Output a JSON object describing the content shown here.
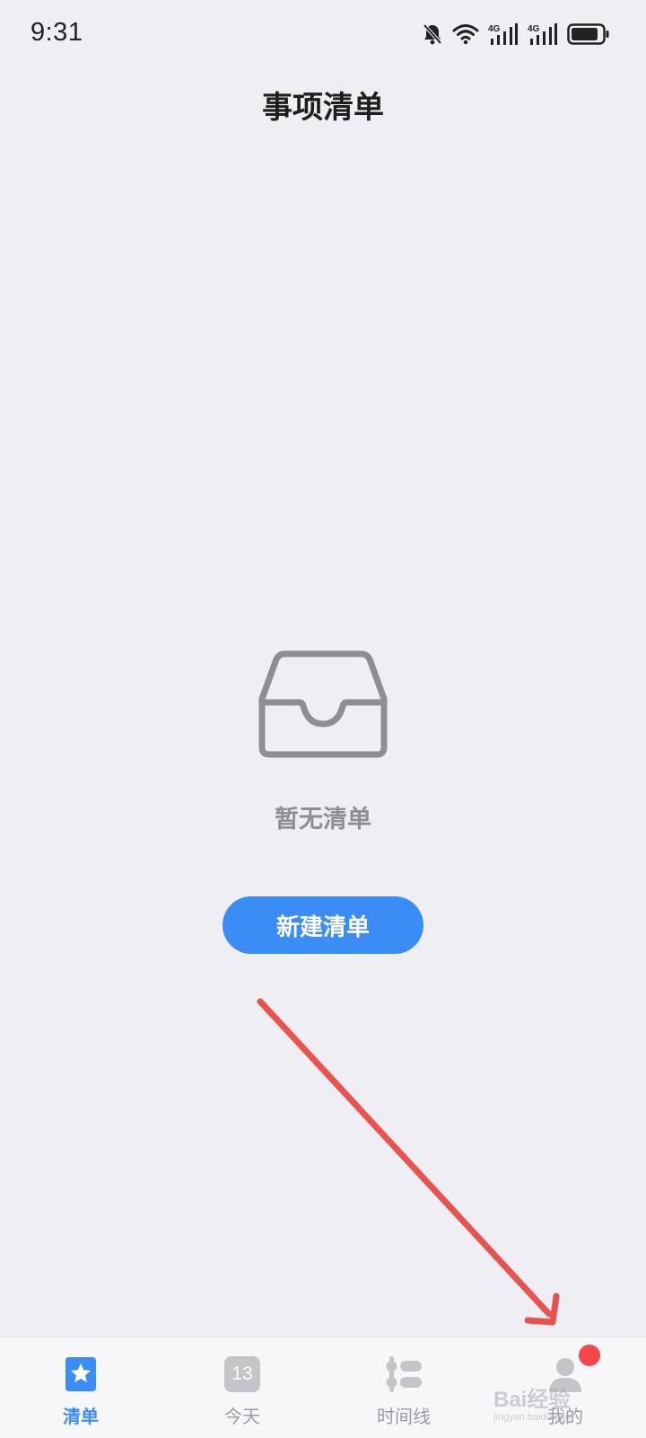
{
  "status_bar": {
    "time": "9:31",
    "icons": [
      "bell-muted-icon",
      "wifi-icon",
      "signal-4g-icon",
      "signal-4g-icon",
      "battery-icon"
    ],
    "network_label_1": "4G",
    "network_label_2": "4G"
  },
  "header": {
    "title": "事项清单"
  },
  "empty_state": {
    "icon": "inbox-tray-icon",
    "message": "暂无清单",
    "button_label": "新建清单"
  },
  "annotation": {
    "type": "arrow",
    "color": "#e8534f"
  },
  "tab_bar": {
    "tabs": [
      {
        "label": "清单",
        "icon": "star-list-icon",
        "active": true
      },
      {
        "label": "今天",
        "icon": "calendar-day-icon",
        "day_number": "13",
        "active": false
      },
      {
        "label": "时间线",
        "icon": "timeline-icon",
        "active": false
      },
      {
        "label": "我的",
        "icon": "user-icon",
        "active": false,
        "badge": true
      }
    ]
  },
  "watermark": {
    "text": "Bai经验",
    "subtext": "jingyan.baidu.com"
  },
  "colors": {
    "accent": "#3b8cf5",
    "background": "#eeeef3",
    "badge": "#f2474b",
    "muted_text": "#8e8e93"
  }
}
